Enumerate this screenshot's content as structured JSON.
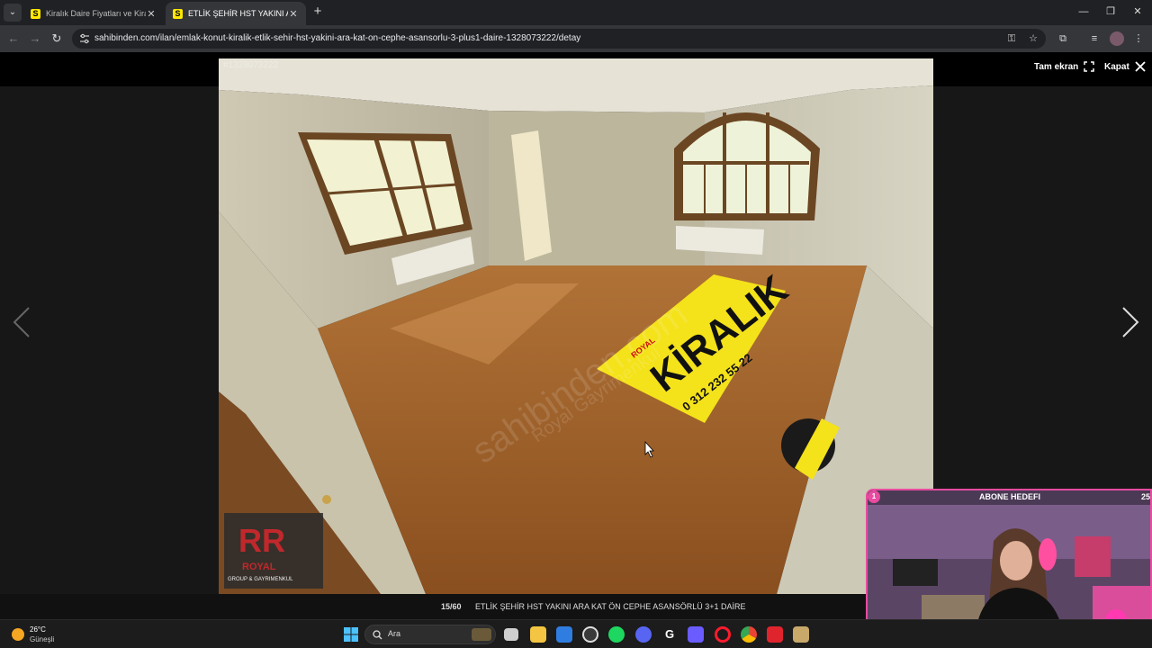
{
  "browser": {
    "tabs": [
      {
        "label": "Kiralık Daire Fiyatları ve Kiralık E",
        "favicon": "S",
        "active": false
      },
      {
        "label": "ETLİK ŞEHİR HST YAKINI ARA KAT ÖN",
        "favicon": "S",
        "active": true
      }
    ],
    "url": "sahibinden.com/ilan/emlak-konut-kiralik-etlik-sehir-hst-yakini-ara-kat-on-cephe-asansorlu-3-plus1-daire-1328073222/detay",
    "icons": [
      "back-icon",
      "forward-icon",
      "reload-icon",
      "site-info-icon",
      "password-key-icon",
      "bookmark-star-icon",
      "extensions-icon",
      "media-control-icon",
      "profile-avatar-icon",
      "menu-icon"
    ]
  },
  "viewer": {
    "photo_id": "#1328073222",
    "fullscreen_label": "Tam ekran",
    "close_label": "Kapat",
    "counter": "15/60",
    "caption": "ETLİK ŞEHİR HST YAKINI ARA KAT ÖN CEPHE ASANSÖRLÜ 3+1 DAİRE",
    "photo": {
      "watermark": "sahibinden.com",
      "watermark2": "Royal Gayrimenkul",
      "banner_text": "KİRALIK",
      "banner_phone": "0 312 232 55 22",
      "banner_brand": "ROYAL",
      "logo_text": "ROYAL",
      "logo_sub": "GROUP & GAYRIMENKUL"
    }
  },
  "stream": {
    "goal_number": "1",
    "goal_label": "ABONE HEDEFI",
    "goal_target": "25"
  },
  "taskbar": {
    "temperature": "26°C",
    "weather_desc": "Güneşli",
    "search_placeholder": "Ara",
    "apps": [
      "windows-start-icon",
      "search-icon",
      "task-view-icon",
      "file-explorer-icon",
      "mail-icon",
      "app-icon",
      "spotify-icon",
      "discord-icon",
      "app-g-icon",
      "grid-app-icon",
      "opera-icon",
      "chrome-icon",
      "red-app-icon",
      "app-icon-2"
    ]
  }
}
